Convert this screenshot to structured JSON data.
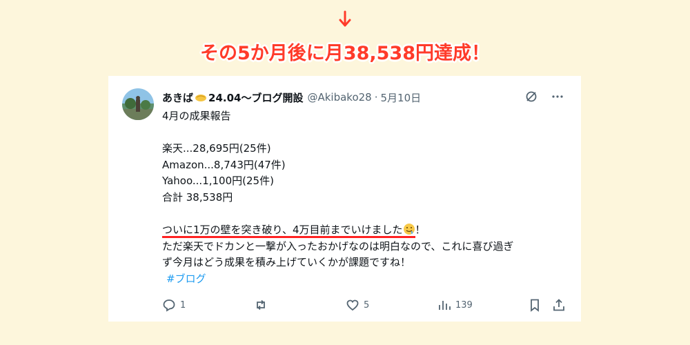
{
  "headline": "その5か月後に月38,538円達成！",
  "tweet": {
    "display_name": "あきば",
    "display_name_suffix": "24.04〜ブログ開設",
    "handle": "@Akibako28",
    "separator": "·",
    "date": "5月10日",
    "lines": [
      "4月の成果報告",
      "",
      "楽天...28,695円(25件)",
      "Amazon...8,743円(47件)",
      "Yahoo...1,100円(25件)",
      "合計 38,538円",
      ""
    ],
    "highlight_text": "ついに1万の壁を突き破り、4万目前までいけました",
    "highlight_after": "！",
    "line2": "ただ楽天でドカンと一撃が入ったおかげなのは明白なので、これに喜び過ぎ",
    "line3": "ず今月はどう成果を積み上げていくかが課題ですね！",
    "hashtag": "#ブログ",
    "stats": {
      "replies": "1",
      "likes": "5",
      "views": "139"
    }
  },
  "colors": {
    "headline": "#ff3b2a",
    "background": "#fdf6dc",
    "underline": "#ff2222",
    "hashtag": "#1d9bf0"
  }
}
